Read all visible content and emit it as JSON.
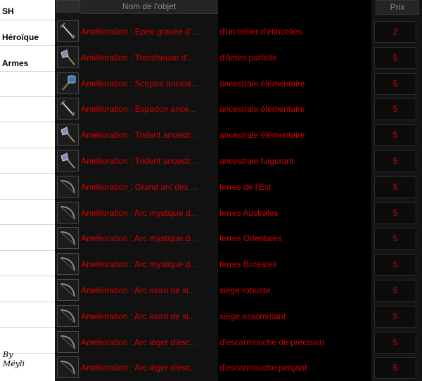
{
  "sidebar": {
    "labels": [
      "SH",
      "Héroïque",
      "Armes"
    ],
    "signature_line1": "By",
    "signature_line2": "Mëyli"
  },
  "header": {
    "name_col": "Nom de l'objet",
    "price_col": "Prix"
  },
  "rows": [
    {
      "icon": "sword-icon",
      "name": "Amélioration : Epée gravée d'...",
      "suffix": "d'un bélier d'étincelles",
      "price": "2"
    },
    {
      "icon": "axe-icon",
      "name": "Amélioration : Trancheuse d'...",
      "suffix": "d'âmes parfaite",
      "price": "5"
    },
    {
      "icon": "scepter-icon",
      "name": "Amélioration : Sceptre ancest...",
      "suffix": "ancestrale élémentaire",
      "price": "5"
    },
    {
      "icon": "sword-icon",
      "name": "Amélioration : Espadon ance...",
      "suffix": "ancestrale élémentaire",
      "price": "5"
    },
    {
      "icon": "axe-icon",
      "name": "Amélioration : Trident ancestr...",
      "suffix": "ancestrale élémentaire",
      "price": "5"
    },
    {
      "icon": "axe-icon",
      "name": "Amélioration : Trident ancestr...",
      "suffix": "ancestrale fulgurant",
      "price": "5"
    },
    {
      "icon": "bow-icon",
      "name": "Amélioration : Grand arc des ...",
      "suffix": "terres de l'Est",
      "price": "5"
    },
    {
      "icon": "bow-icon",
      "name": "Amélioration : Arc mystique d...",
      "suffix": "terres Australes",
      "price": "5"
    },
    {
      "icon": "bow-icon",
      "name": "Amélioration : Arc mystique d...",
      "suffix": "terres Orientales",
      "price": "5"
    },
    {
      "icon": "bow-icon",
      "name": "Amélioration : Arc mystique d...",
      "suffix": "terres Boréales",
      "price": "5"
    },
    {
      "icon": "bow-icon",
      "name": "Amélioration : Arc lourd de si...",
      "suffix": "siège robuste",
      "price": "5"
    },
    {
      "icon": "bow-icon",
      "name": "Amélioration : Arc lourd de si...",
      "suffix": "siège assommant",
      "price": "5"
    },
    {
      "icon": "bow-icon",
      "name": "Amélioration : Arc léger d'esc...",
      "suffix": "d'escarmouche de précision",
      "price": "5"
    },
    {
      "icon": "bow-icon",
      "name": "Amélioration : Arc léger d'esc...",
      "suffix": "d'escarmouche perçant",
      "price": "5"
    }
  ]
}
